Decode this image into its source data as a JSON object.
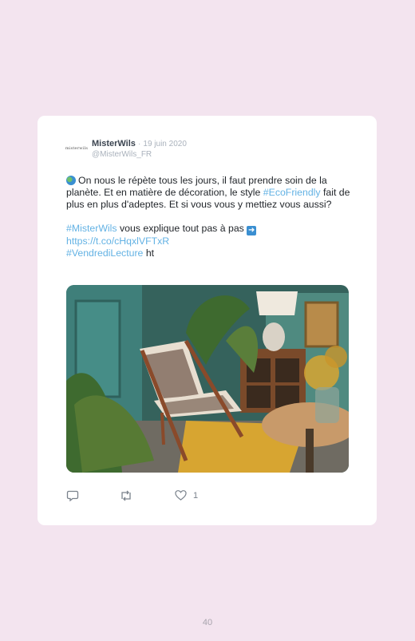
{
  "tweet": {
    "avatar_text": "misterwils",
    "author_name": "MisterWils",
    "separator": "·",
    "date": "19 juin 2020",
    "handle": "@MisterWils_FR",
    "body_line1": "On nous le répète tous les jours, il faut prendre soin de la planète. Et en matière de décoration, le style ",
    "hashtag_eco": "#EcoFriendly",
    "body_line1_end": " fait de plus en plus d'adeptes. Et si vous vous y mettiez vous aussi?",
    "hashtag_misterwils": "#MisterWils",
    "body_line2": " vous explique tout pas à pas ",
    "link_url": "https://t.co/cHqxlVFTxR",
    "hashtag_vendredi": "#VendrediLecture",
    "body_trailing": " ht",
    "like_count": "1",
    "icons": {
      "globe": "earth-globe-emoji",
      "arrow": "right-arrow-emoji",
      "reply": "reply-icon",
      "retweet": "retweet-icon",
      "like": "heart-icon"
    }
  },
  "page": {
    "number": "40",
    "background": "#f3e4ef",
    "link_color": "#63b2e4"
  }
}
